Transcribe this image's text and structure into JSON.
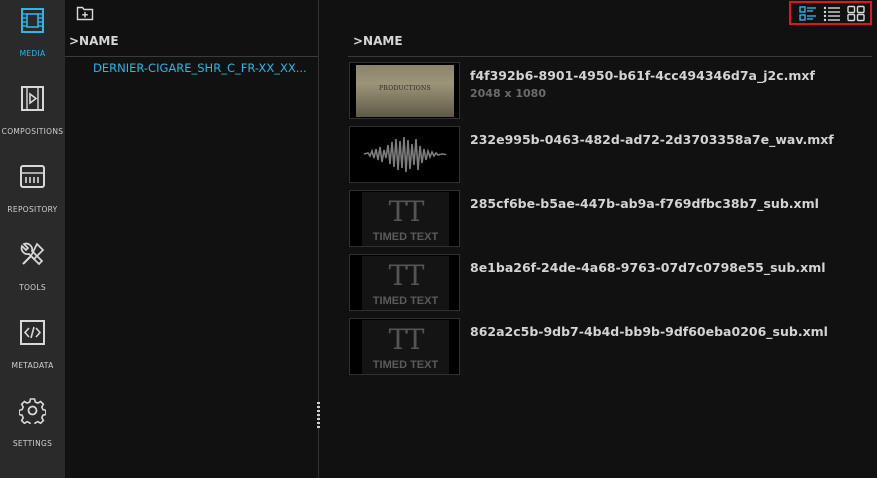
{
  "sidebar": {
    "items": [
      {
        "label": "MEDIA",
        "icon": "film-icon",
        "active": true
      },
      {
        "label": "COMPOSITIONS",
        "icon": "composition-icon",
        "active": false
      },
      {
        "label": "REPOSITORY",
        "icon": "repository-icon",
        "active": false
      },
      {
        "label": "TOOLS",
        "icon": "tools-icon",
        "active": false
      },
      {
        "label": "METADATA",
        "icon": "code-icon",
        "active": false
      },
      {
        "label": "SETTINGS",
        "icon": "gear-icon",
        "active": false
      }
    ]
  },
  "left_pane": {
    "header": ">NAME",
    "folders": [
      "DERNIER-CIGARE_SHR_C_FR-XX_XX..."
    ]
  },
  "right_pane": {
    "header": ">NAME",
    "view_modes": [
      "detail-list-view",
      "list-view",
      "grid-view"
    ],
    "files": [
      {
        "name": "f4f392b6-8901-4950-b61f-4cc494346d7a_j2c.mxf",
        "meta": "2048 x 1080",
        "thumb": "video",
        "thumb_text": "PRODUCTIONS"
      },
      {
        "name": "232e995b-0463-482d-ad72-2d3703358a7e_wav.mxf",
        "meta": "",
        "thumb": "audio"
      },
      {
        "name": "285cf6be-b5ae-447b-ab9a-f769dfbc38b7_sub.xml",
        "meta": "",
        "thumb": "timedtext",
        "thumb_big": "TT",
        "thumb_label": "TIMED TEXT"
      },
      {
        "name": "8e1ba26f-24de-4a68-9763-07d7c0798e55_sub.xml",
        "meta": "",
        "thumb": "timedtext",
        "thumb_big": "TT",
        "thumb_label": "TIMED TEXT"
      },
      {
        "name": "862a2c5b-9db7-4b4d-bb9b-9df60eba0206_sub.xml",
        "meta": "",
        "thumb": "timedtext",
        "thumb_big": "TT",
        "thumb_label": "TIMED TEXT"
      }
    ]
  },
  "colors": {
    "accent": "#29b6e8",
    "highlight_border": "#e0161c",
    "sidebar_bg": "#2a2a2a",
    "content_bg": "#111111"
  }
}
